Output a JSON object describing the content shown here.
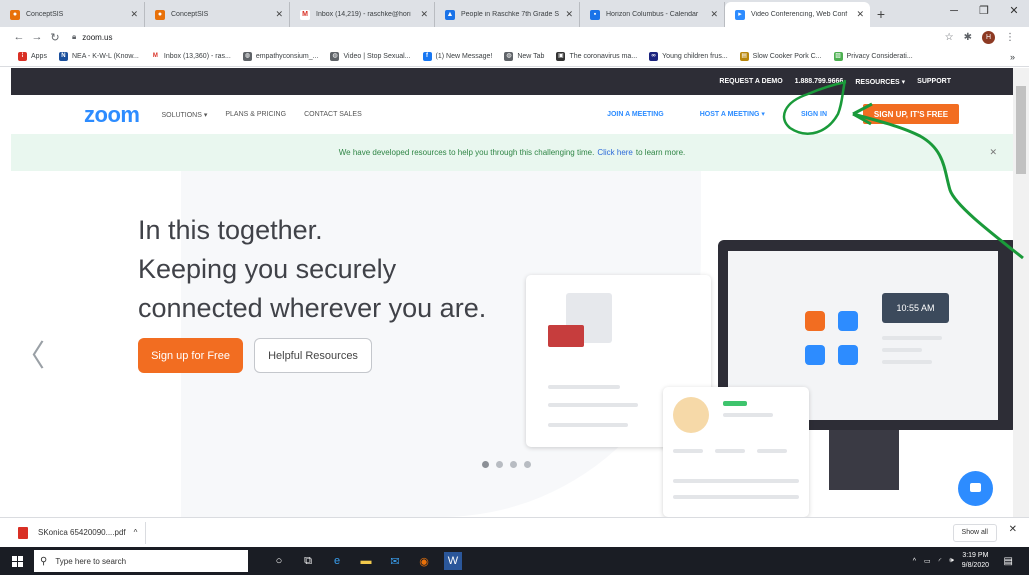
{
  "browser": {
    "tabs": [
      {
        "title": "ConceptSIS",
        "icon": "conceptsis-icon",
        "color": "#e8710a",
        "active": false
      },
      {
        "title": "ConceptSIS",
        "icon": "conceptsis-icon",
        "color": "#e8710a",
        "active": false
      },
      {
        "title": "Inbox (14,219) - raschke@hori",
        "icon": "gmail-icon",
        "color": "#d93025",
        "active": false
      },
      {
        "title": "People in Raschke 7th Grade S",
        "icon": "canvas-icon",
        "color": "#1a73e8",
        "active": false
      },
      {
        "title": "Horizon Columbus - Calendar",
        "icon": "calendar-icon",
        "color": "#1a73e8",
        "active": false
      },
      {
        "title": "Video Conferencing, Web Conf",
        "icon": "zoom-icon",
        "color": "#2d8cff",
        "active": true
      }
    ],
    "url": "zoom.us",
    "profile_initial": "H",
    "bookmarks": [
      {
        "label": "Apps",
        "icon": "apps-grid-icon",
        "color": "#d93025"
      },
      {
        "label": "NEA - K-W-L (Know...",
        "icon": "nea-icon",
        "color": "#1a4f9c"
      },
      {
        "label": "Inbox (13,360) - ras...",
        "icon": "gmail-icon",
        "color": "#d93025"
      },
      {
        "label": "empathyconsium_...",
        "icon": "globe-icon",
        "color": "#5f6368"
      },
      {
        "label": "Video | Stop Sexual...",
        "icon": "globe-icon",
        "color": "#5f6368"
      },
      {
        "label": "(1) New Message!",
        "icon": "facebook-icon",
        "color": "#1877f2"
      },
      {
        "label": "New Tab",
        "icon": "globe-icon",
        "color": "#5f6368"
      },
      {
        "label": "The coronavirus ma...",
        "icon": "news-icon",
        "color": "#333333"
      },
      {
        "label": "Young children frus...",
        "icon": "link-icon",
        "color": "#1a237e"
      },
      {
        "label": "Slow Cooker Pork C...",
        "icon": "recipe-icon",
        "color": "#b8860b"
      },
      {
        "label": "Privacy Considerati...",
        "icon": "image-icon",
        "color": "#4caf50"
      }
    ]
  },
  "zoom": {
    "topbar": {
      "request_demo": "REQUEST A DEMO",
      "phone": "1.888.799.9666",
      "resources": "RESOURCES ▾",
      "support": "SUPPORT"
    },
    "logo": "zoom",
    "nav_left": [
      "SOLUTIONS ▾",
      "PLANS & PRICING",
      "CONTACT SALES"
    ],
    "nav_right": {
      "join": "JOIN A MEETING",
      "host": "HOST A MEETING ▾",
      "signin": "SIGN IN",
      "signup": "SIGN UP, IT'S FREE"
    },
    "banner": {
      "text_before": "We have developed resources to help you through this challenging time.",
      "link": "Click here",
      "text_after": "to learn more."
    },
    "hero": {
      "line1": "In this together.",
      "line2": "Keeping you securely",
      "line3": "connected wherever you are.",
      "cta_primary": "Sign up for Free",
      "cta_secondary": "Helpful Resources",
      "meeting_time": "10:55 AM"
    }
  },
  "downloads": {
    "file": "SKonica 65420090....pdf",
    "show_all": "Show all"
  },
  "taskbar": {
    "search_placeholder": "Type here to search",
    "time": "3:19 PM",
    "date": "9/8/2020"
  },
  "colors": {
    "zoom_blue": "#2d8cff",
    "signup_orange": "#f26d21",
    "annotation_green": "#1a9a3a"
  }
}
